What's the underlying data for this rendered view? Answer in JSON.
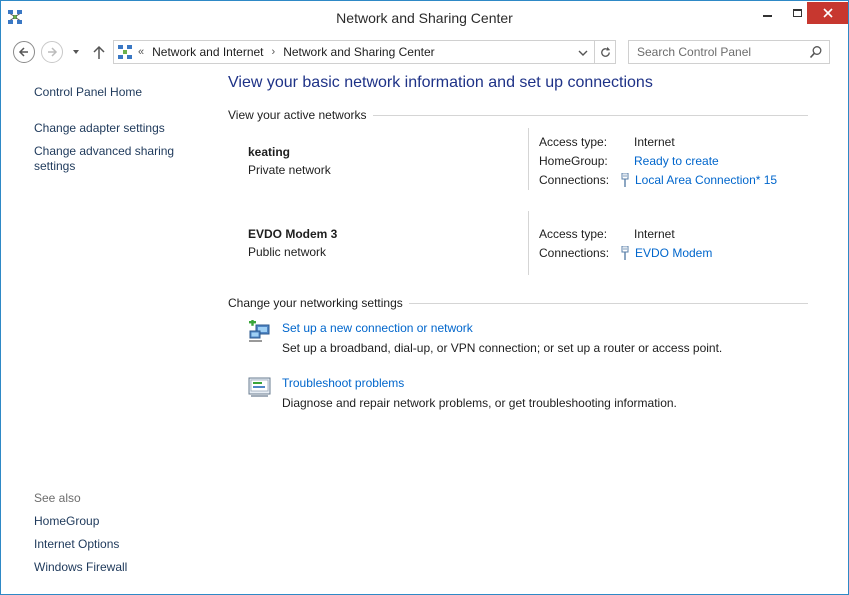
{
  "window": {
    "title": "Network and Sharing Center"
  },
  "nav": {
    "crumb_start": "«",
    "breadcrumbs": [
      "Network and Internet",
      "Network and Sharing Center"
    ],
    "crumb_separator": "›",
    "search_placeholder": "Search Control Panel"
  },
  "left_pane": {
    "home": "Control Panel Home",
    "links": [
      "Change adapter settings",
      "Change advanced sharing settings"
    ],
    "see_also_label": "See also",
    "see_also": [
      "HomeGroup",
      "Internet Options",
      "Windows Firewall"
    ]
  },
  "main": {
    "heading": "View your basic network information and set up connections",
    "active_networks_label": "View your active networks",
    "networks": [
      {
        "name": "keating",
        "type": "Private network",
        "access_type_label": "Access type:",
        "access_type": "Internet",
        "homegroup_label": "HomeGroup:",
        "homegroup": "Ready to create",
        "connections_label": "Connections:",
        "connection": "Local Area Connection* 15"
      },
      {
        "name": "EVDO Modem  3",
        "type": "Public network",
        "access_type_label": "Access type:",
        "access_type": "Internet",
        "connections_label": "Connections:",
        "connection": "EVDO Modem"
      }
    ],
    "change_settings_label": "Change your networking settings",
    "tasks": [
      {
        "link": "Set up a new connection or network",
        "desc": "Set up a broadband, dial-up, or VPN connection; or set up a router or access point."
      },
      {
        "link": "Troubleshoot problems",
        "desc": "Diagnose and repair network problems, or get troubleshooting information."
      }
    ]
  },
  "colors": {
    "link": "#0066cc",
    "heading": "#1e3287",
    "left_link": "#1e395b",
    "border": "#2e89c6",
    "close": "#c7372f"
  }
}
